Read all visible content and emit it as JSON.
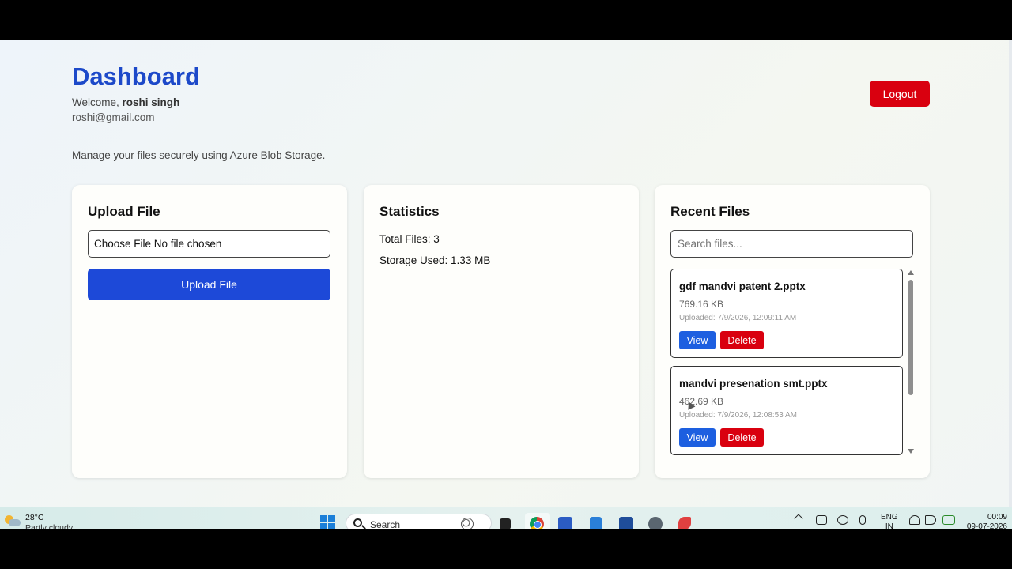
{
  "header": {
    "title": "Dashboard",
    "welcome_prefix": "Welcome, ",
    "user_name": "roshi singh",
    "email": "roshi@gmail.com",
    "logout_label": "Logout",
    "subtitle": "Manage your files securely using Azure Blob Storage."
  },
  "upload": {
    "title": "Upload File",
    "file_input_text": "Choose File No file chosen",
    "button_label": "Upload File"
  },
  "stats": {
    "title": "Statistics",
    "total_files": "Total Files: 3",
    "storage_used": "Storage Used: 1.33 MB"
  },
  "recent": {
    "title": "Recent Files",
    "search_placeholder": "Search files...",
    "files": [
      {
        "name": "gdf mandvi patent 2.pptx",
        "size": "769.16 KB",
        "uploaded": "Uploaded: 7/9/2026, 12:09:11 AM",
        "view_label": "View",
        "delete_label": "Delete"
      },
      {
        "name": "mandvi presenation smt.pptx",
        "size": "462.69 KB",
        "uploaded": "Uploaded: 7/9/2026, 12:08:53 AM",
        "view_label": "View",
        "delete_label": "Delete"
      }
    ]
  },
  "taskbar": {
    "temperature": "28°C",
    "condition": "Partly cloudy",
    "search_label": "Search",
    "lang_1": "ENG",
    "lang_2": "IN",
    "time": "00:09",
    "date": "09-07-2026"
  },
  "colors": {
    "title_blue": "#1d49c9",
    "primary_button": "#1d49d8",
    "danger": "#d9000f",
    "view_button": "#1d5fe0"
  }
}
